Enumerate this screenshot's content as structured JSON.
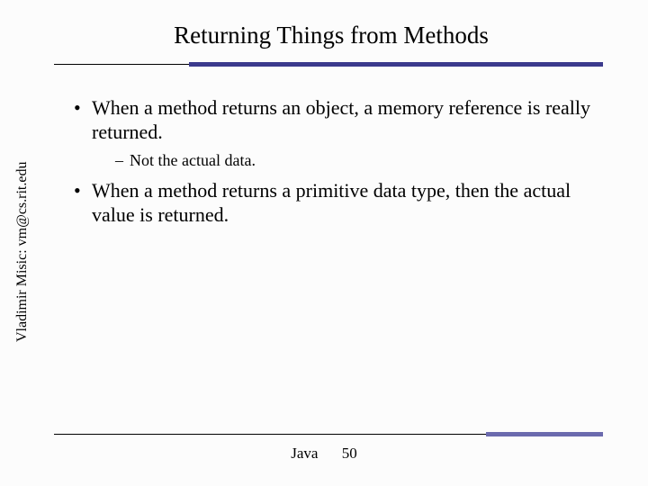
{
  "title": "Returning Things from Methods",
  "bullets": {
    "b1": "When a method returns an object, a memory reference is really returned.",
    "b1_sub": "Not the actual data.",
    "b2": "When a method returns a primitive data type, then the actual value is returned."
  },
  "sidebar": "Vladimir Misic: vm@cs.rit.edu",
  "footer": {
    "label": "Java",
    "page": "50"
  }
}
